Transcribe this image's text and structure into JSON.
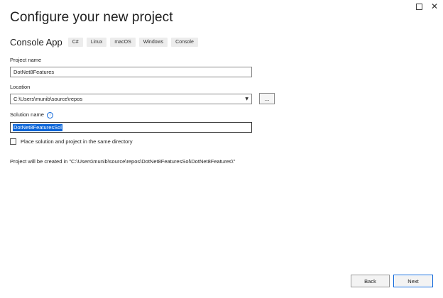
{
  "window": {
    "maximize_icon": "maximize-icon",
    "close_icon": "close-icon",
    "close_glyph": "✕"
  },
  "header": {
    "title": "Configure your new project",
    "template_name": "Console App",
    "tags": [
      "C#",
      "Linux",
      "macOS",
      "Windows",
      "Console"
    ]
  },
  "form": {
    "project_name_label": "Project name",
    "project_name_value": "DotNet8Features",
    "location_label": "Location",
    "location_value": "C:\\Users\\munib\\source\\repos",
    "location_dropdown_glyph": "▼",
    "browse_label": "...",
    "solution_name_label": "Solution name",
    "info_glyph": "i",
    "solution_name_value": "DotNet8FeaturesSol",
    "same_dir_label": "Place solution and project in the same directory",
    "same_dir_checked": false,
    "path_note": "Project will be created in \"C:\\Users\\munib\\source\\repos\\DotNet8FeaturesSol\\DotNet8Features\\\""
  },
  "footer": {
    "back_label": "Back",
    "next_label": "Next"
  },
  "colors": {
    "accent": "#0a64d8",
    "tag_bg": "#ececec"
  }
}
